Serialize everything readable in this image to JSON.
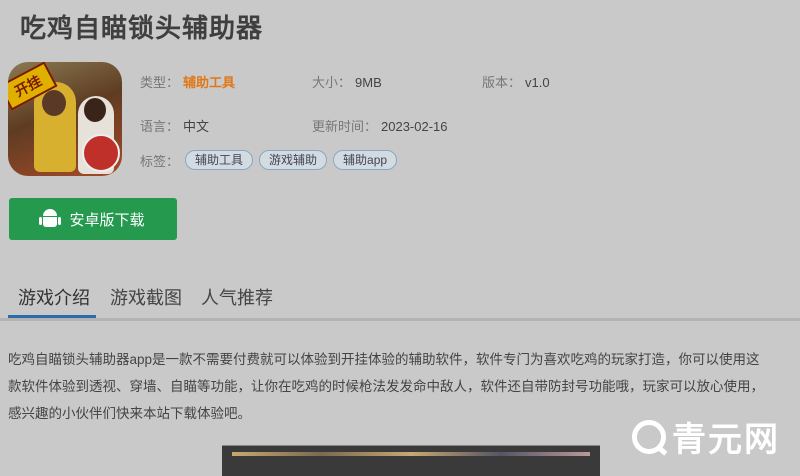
{
  "title": "吃鸡自瞄锁头辅助器",
  "meta": {
    "type_label": "类型：",
    "type_value": "辅助工具",
    "size_label": "大小：",
    "size_value": "9MB",
    "version_label": "版本：",
    "version_value": "v1.0",
    "lang_label": "语言：",
    "lang_value": "中文",
    "updated_label": "更新时间：",
    "updated_value": "2023-02-16"
  },
  "tags": {
    "label": "标签：",
    "items": [
      "辅助工具",
      "游戏辅助",
      "辅助app"
    ]
  },
  "icon_badge": "开挂",
  "download": {
    "label": "安卓版下载",
    "icon": "android-icon"
  },
  "tabs": [
    {
      "label": "游戏介绍",
      "active": true
    },
    {
      "label": "游戏截图",
      "active": false
    },
    {
      "label": "人气推荐",
      "active": false
    }
  ],
  "description": {
    "line1": "吃鸡自瞄锁头辅助器app是一款不需要付费就可以体验到开挂体验的辅助软件，软件专门为喜欢吃鸡的玩家打造，你可以使用这",
    "line2": "款软件体验到透视、穿墙、自瞄等功能，让你在吃鸡的时候枪法发发命中敌人，软件还自带防封号功能哦，玩家可以放心使用，",
    "line3": "感兴趣的小伙伴们快来本站下载体验吧。"
  },
  "watermark": {
    "text": "青元网",
    "icon": "magnifier-q-icon"
  },
  "colors": {
    "accent_orange": "#e07818",
    "download_green": "#259a4f",
    "tab_underline": "#2d6aa6"
  }
}
